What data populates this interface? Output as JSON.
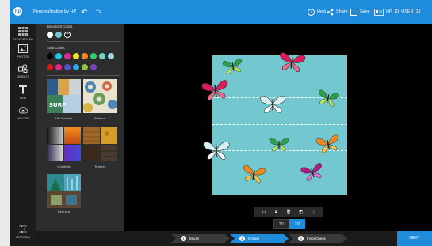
{
  "topbar": {
    "logo_text": "hp",
    "title": "Personalization by HP",
    "help_label": "Help",
    "share_label": "Share",
    "save_label": "Save",
    "user_label": "HP_ID_USER_12"
  },
  "rail": {
    "items": [
      {
        "label": "BACKGROUND",
        "icon": "background-icon"
      },
      {
        "label": "PHOTOS",
        "icon": "photos-icon"
      },
      {
        "label": "OBJECTS",
        "icon": "objects-icon"
      },
      {
        "label": "TEXT",
        "icon": "text-icon"
      },
      {
        "label": "UPLOAD",
        "icon": "upload-icon"
      }
    ],
    "settings_label": "SETTINGS"
  },
  "panel": {
    "document_colors_label": "Document Colors",
    "document_colors": [
      "#ffffff",
      "#73c7cf"
    ],
    "solid_colors_label": "Solid Colors",
    "solid_colors_row1": [
      "#000000",
      "#1ec8e8",
      "#e8258d",
      "#f2e31f",
      "#f08a1c",
      "#2bd36b",
      "#6fd6c0",
      "#9fd8e0"
    ],
    "solid_colors_row2": [
      "#d51b1b",
      "#e8258d",
      "#4f53c7",
      "#2fa8e6",
      "#8cc63e",
      "#7e3fc1"
    ],
    "thumbs": [
      {
        "label": "HP Samples"
      },
      {
        "label": "Patterns"
      },
      {
        "label": "Gradients"
      },
      {
        "label": "Textures"
      },
      {
        "label": "Featured"
      }
    ]
  },
  "canvas": {
    "background": "#73c7cf"
  },
  "view": {
    "options": [
      "3D",
      "2D"
    ],
    "active": "2D"
  },
  "steps": [
    {
      "num": "1",
      "label": "Model"
    },
    {
      "num": "2",
      "label": "Design"
    },
    {
      "num": "3",
      "label": "Final Check"
    }
  ],
  "next_label": "NEXT"
}
